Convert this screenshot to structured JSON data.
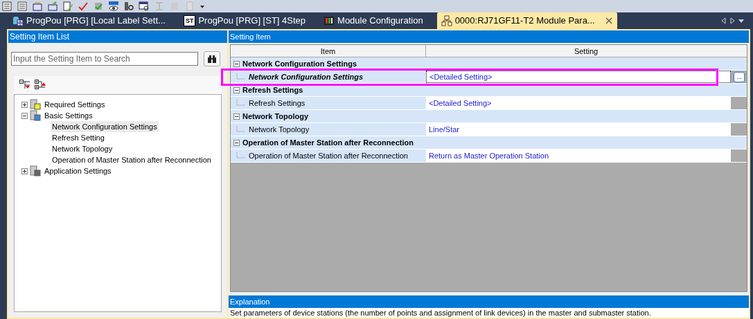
{
  "tabs": [
    {
      "label": "ProgPou [PRG] [Local Label Sett...",
      "kind": "label",
      "selected": false
    },
    {
      "label": "ProgPou [PRG] [ST] 4Step",
      "kind": "st",
      "badge": "ST",
      "selected": false
    },
    {
      "label": "Module Configuration",
      "kind": "module",
      "selected": false
    },
    {
      "label": "0000:RJ71GF11-T2 Module Para...",
      "kind": "parameter",
      "selected": true
    }
  ],
  "left_panel": {
    "title": "Setting Item List",
    "search": {
      "placeholder": "Input the Setting Item to Search"
    },
    "tree": [
      {
        "label": "Required Settings",
        "expanded": false,
        "selected": false
      },
      {
        "label": "Basic Settings",
        "expanded": true,
        "selected": false,
        "children": [
          {
            "label": "Network Configuration Settings",
            "selected": true
          },
          {
            "label": "Refresh Setting",
            "selected": false
          },
          {
            "label": "Network Topology",
            "selected": false
          },
          {
            "label": "Operation of Master Station after Reconnection",
            "selected": false
          }
        ]
      },
      {
        "label": "Application Settings",
        "expanded": false,
        "selected": false
      }
    ]
  },
  "right_panel": {
    "title": "Setting Item",
    "columns": [
      "Item",
      "Setting"
    ],
    "groups": [
      {
        "title": "Network Configuration Settings",
        "expanded": true,
        "rows": [
          {
            "item": "Network Configuration Settings",
            "setting": "<Detailed Setting>",
            "button": "...",
            "selected": true,
            "highlighted": true
          }
        ]
      },
      {
        "title": "Refresh Settings",
        "expanded": true,
        "rows": [
          {
            "item": "Refresh Settings",
            "setting": "<Detailed Setting>",
            "selected": false,
            "highlighted": false
          }
        ]
      },
      {
        "title": "Network Topology",
        "expanded": true,
        "rows": [
          {
            "item": "Network Topology",
            "setting": "Line/Star",
            "selected": false,
            "highlighted": false
          }
        ]
      },
      {
        "title": "Operation of Master Station after Reconnection",
        "expanded": true,
        "rows": [
          {
            "item": "Operation of Master Station after Reconnection",
            "setting": "Return as Master Operation Station",
            "selected": false,
            "highlighted": false
          }
        ]
      }
    ]
  },
  "explanation": {
    "title": "Explanation",
    "text": "Set parameters of device stations (the number of points and assignment of link devices) in the master and submaster station."
  }
}
